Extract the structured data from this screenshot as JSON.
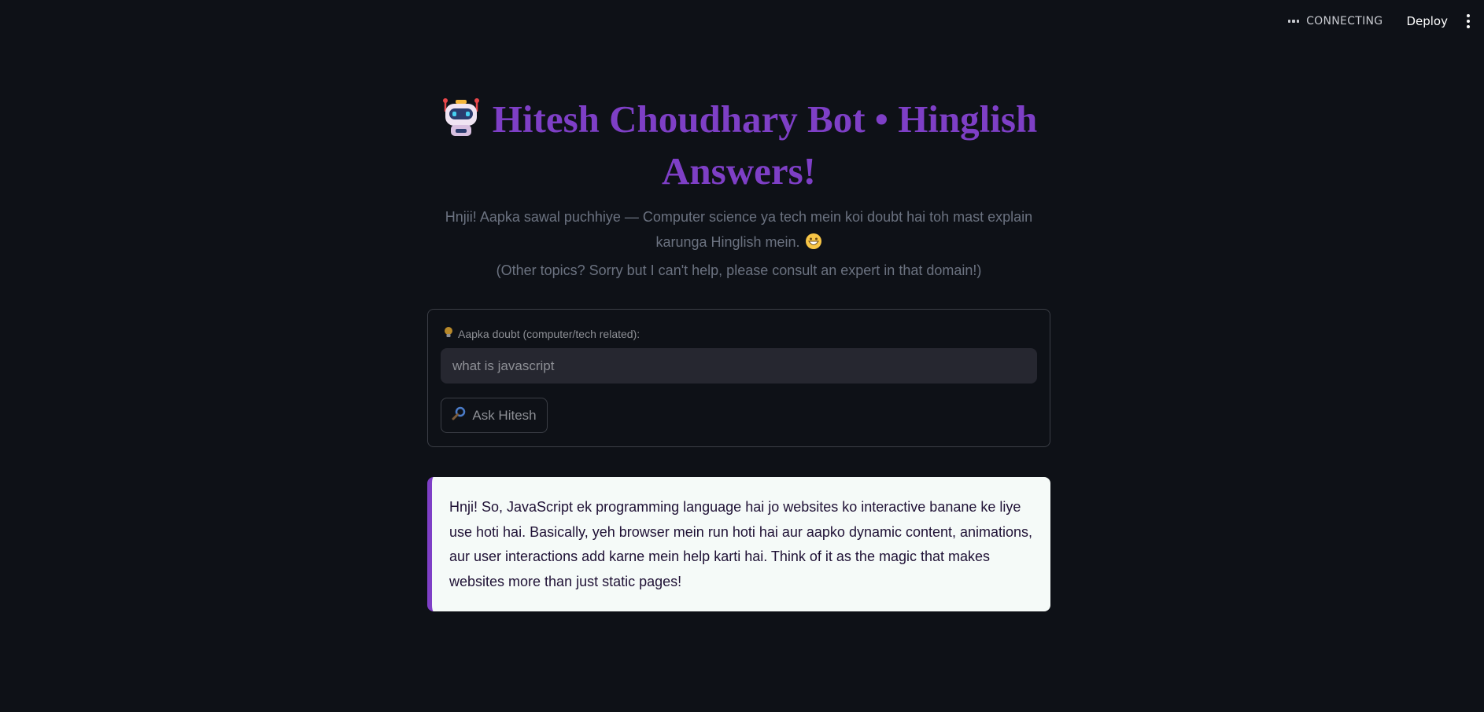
{
  "header": {
    "status_text": "CONNECTING",
    "deploy_label": "Deploy"
  },
  "page": {
    "title": "Hitesh Choudhary Bot • Hinglish Answers!",
    "subtitle_line1": "Hnjii! Aapka sawal puchhiye — Computer science ya tech mein koi doubt hai toh mast explain karunga Hinglish mein.",
    "subtitle_line2": "(Other topics? Sorry but I can't help, please consult an expert in that domain!)"
  },
  "form": {
    "label": "Aapka doubt (computer/tech related):",
    "input_value": "what is javascript",
    "ask_label": "Ask Hitesh"
  },
  "answer": {
    "text": "Hnji! So, JavaScript ek programming language hai jo websites ko interactive banane ke liye use hoti hai. Basically, yeh browser mein run hoti hai aur aapko dynamic content, animations, aur user interactions add karne mein help karti hai. Think of it as the magic that makes websites more than just static pages!"
  },
  "colors": {
    "background": "#0e1117",
    "accent": "#7e3fc6",
    "answer_bg": "#f5faf8"
  },
  "icons": {
    "status": "more-dots-icon",
    "menu": "vertical-dots-menu-icon",
    "title": "robot-icon",
    "subtitle": "grinning-face-icon",
    "label": "lightbulb-icon",
    "button": "magnifier-icon"
  }
}
